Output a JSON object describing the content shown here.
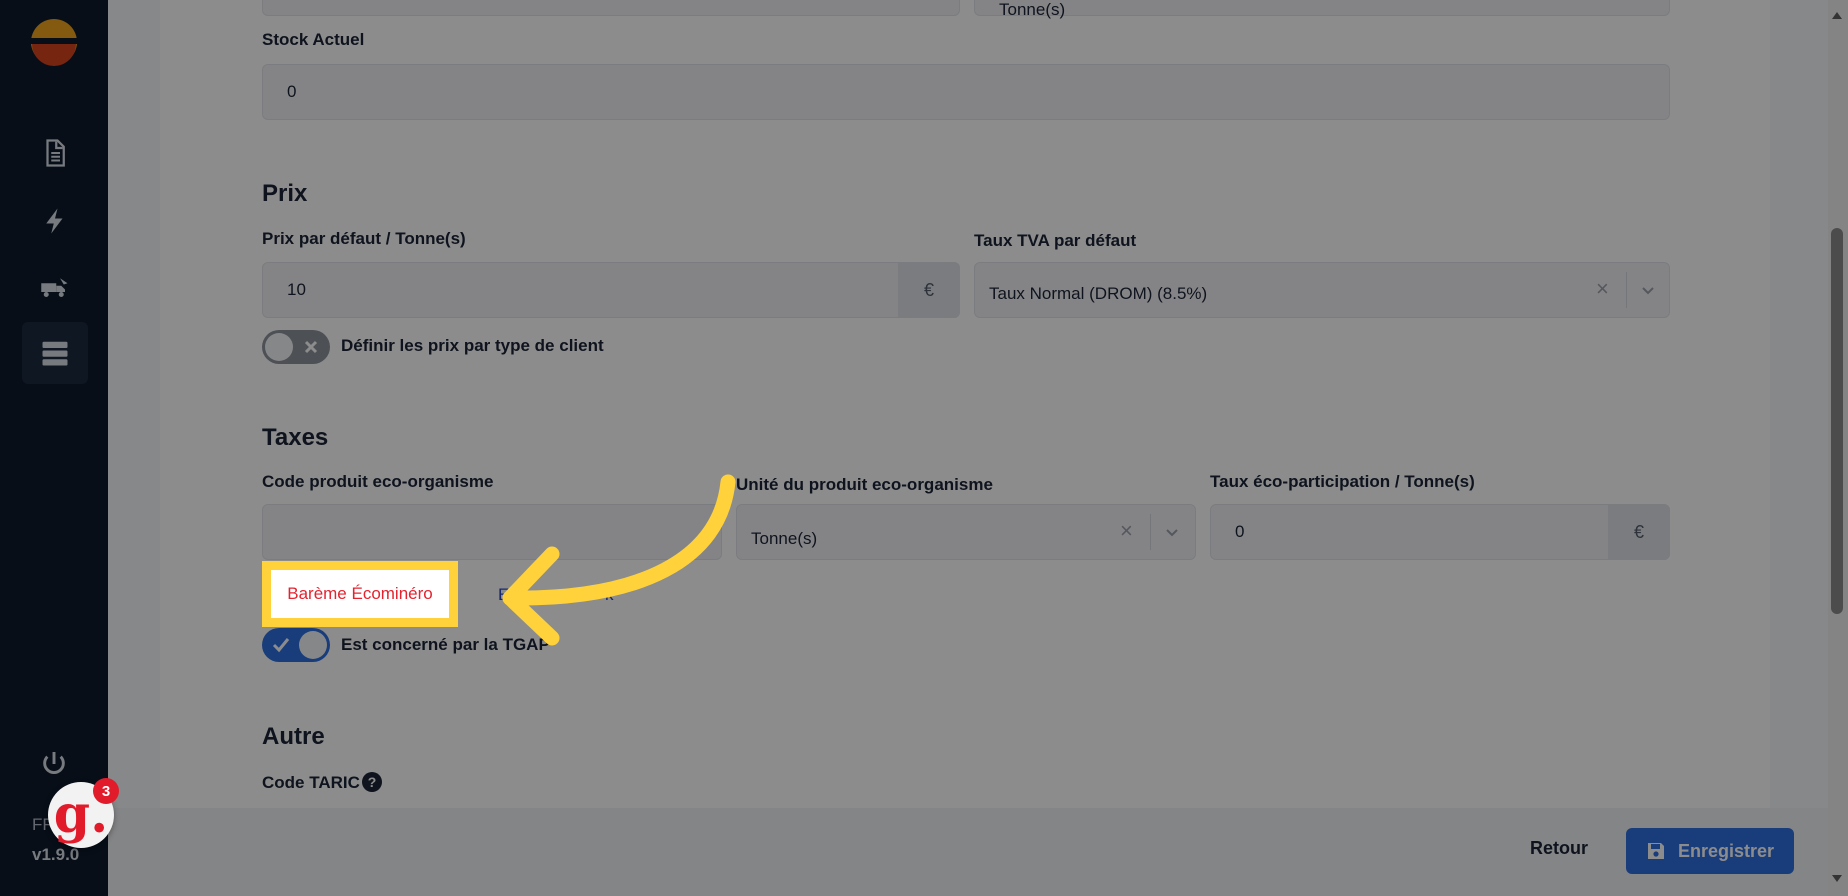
{
  "app": {
    "lang": "FR",
    "version": "v1.9.0",
    "badge_letter": "g.",
    "badge_count": "3"
  },
  "form": {
    "partial_unit": "Tonne(s)",
    "stock": {
      "label": "Stock Actuel",
      "value": "0"
    },
    "prix": {
      "title": "Prix",
      "default_price_label": "Prix par défaut / Tonne(s)",
      "default_price_value": "10",
      "currency": "€",
      "vat_label": "Taux TVA par défaut",
      "vat_value": "Taux Normal (DROM) (8.5%)",
      "toggle_label": "Définir les prix par type de client",
      "toggle_on": false
    },
    "taxes": {
      "title": "Taxes",
      "code_label": "Code produit eco-organisme",
      "code_value": "",
      "unit_label": "Unité du produit eco-organisme",
      "unit_value": "Tonne(s)",
      "rate_label": "Taux éco-participation / Tonne(s)",
      "rate_value": "0",
      "currency": "€",
      "link_bareme": "Barème Écominéro",
      "link_partial_a": "E",
      "link_partial_b": "k",
      "tgap_label": "Est concerné par la TGAP",
      "tgap_on": true
    },
    "autre": {
      "title": "Autre",
      "taric_label": "Code TARIC",
      "help": "?"
    }
  },
  "footer": {
    "back_label": "Retour",
    "save_label": "Enregistrer"
  },
  "annotation": {
    "color": "#ffd23c"
  }
}
